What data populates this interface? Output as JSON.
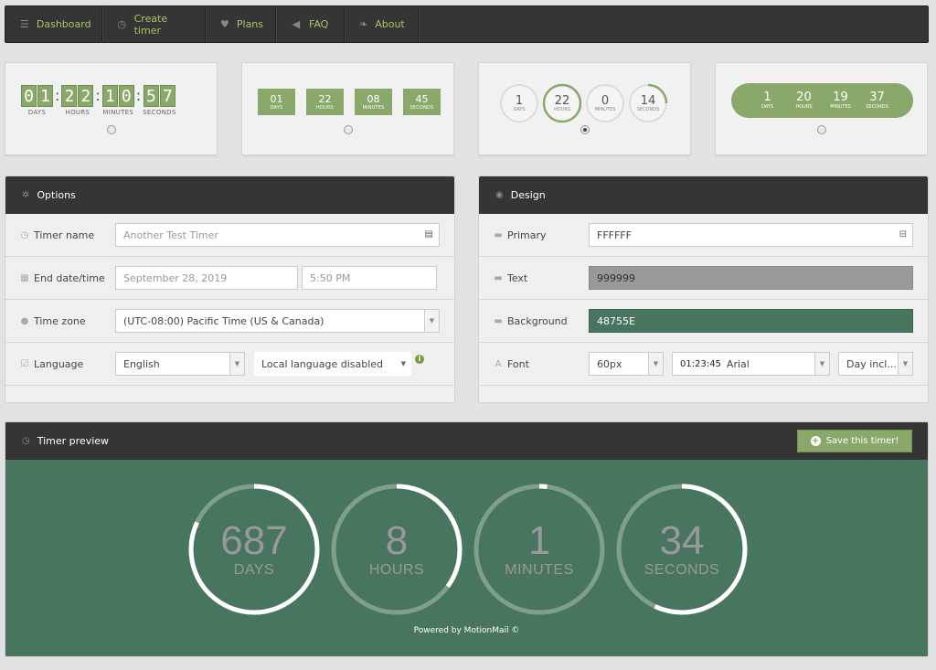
{
  "nav": [
    {
      "label": "Dashboard",
      "icon": "menu-icon",
      "glyph": "☰"
    },
    {
      "label": "Create timer",
      "icon": "clock-icon",
      "glyph": "◷"
    },
    {
      "label": "Plans",
      "icon": "heart-icon",
      "glyph": "♥"
    },
    {
      "label": "FAQ",
      "icon": "megaphone-icon",
      "glyph": "◀"
    },
    {
      "label": "About",
      "icon": "leaf-icon",
      "glyph": "❧"
    }
  ],
  "themes": {
    "flip": {
      "units": [
        {
          "value": "01",
          "label": "DAYS"
        },
        {
          "value": "22",
          "label": "HOURS"
        },
        {
          "value": "10",
          "label": "MINUTES"
        },
        {
          "value": "57",
          "label": "SECONDS"
        }
      ]
    },
    "boxes": {
      "units": [
        {
          "value": "01",
          "label": "DAYS"
        },
        {
          "value": "22",
          "label": "HOURS"
        },
        {
          "value": "08",
          "label": "MINUTES"
        },
        {
          "value": "45",
          "label": "SECONDS"
        }
      ]
    },
    "circles": {
      "units": [
        {
          "value": "1",
          "label": "DAYS"
        },
        {
          "value": "22",
          "label": "HOURS"
        },
        {
          "value": "0",
          "label": "MINUTES"
        },
        {
          "value": "14",
          "label": "SECONDS"
        }
      ]
    },
    "pill": {
      "units": [
        {
          "value": "1",
          "label": "DAYS"
        },
        {
          "value": "20",
          "label": "HOURS"
        },
        {
          "value": "19",
          "label": "MINUTES"
        },
        {
          "value": "37",
          "label": "SECONDS"
        }
      ]
    },
    "selected": 2
  },
  "options": {
    "title": "Options",
    "timer_name_label": "Timer name",
    "timer_name_placeholder": "Another Test Timer",
    "end_label": "End date/time",
    "end_date": "September 28, 2019",
    "end_time": "5:50 PM",
    "timezone_label": "Time zone",
    "timezone_value": "(UTC-08:00) Pacific Time (US & Canada)",
    "language_label": "Language",
    "language_value": "English",
    "local_language_value": "Local language disabled"
  },
  "design": {
    "title": "Design",
    "primary_label": "Primary",
    "primary_value": "FFFFFF",
    "text_label": "Text",
    "text_value": "999999",
    "background_label": "Background",
    "background_value": "48755E",
    "font_label": "Font",
    "font_size": "60px",
    "font_sample": "01:23:45",
    "font_name": "Arial",
    "day_option": "Day incl..."
  },
  "preview": {
    "title": "Timer preview",
    "save_label": "Save this timer!",
    "units": [
      {
        "value": "687",
        "label": "DAYS",
        "progress": 0.82
      },
      {
        "value": "8",
        "label": "HOURS",
        "progress": 0.35
      },
      {
        "value": "1",
        "label": "MINUTES",
        "progress": 0.02
      },
      {
        "value": "34",
        "label": "SECONDS",
        "progress": 0.57
      }
    ],
    "powered_by": "Powered by MotionMail ©"
  },
  "colors": {
    "accent": "#8aa86a",
    "dark": "#353535",
    "preview_bg": "#48755e",
    "text": "#999999",
    "primary": "#ffffff"
  }
}
